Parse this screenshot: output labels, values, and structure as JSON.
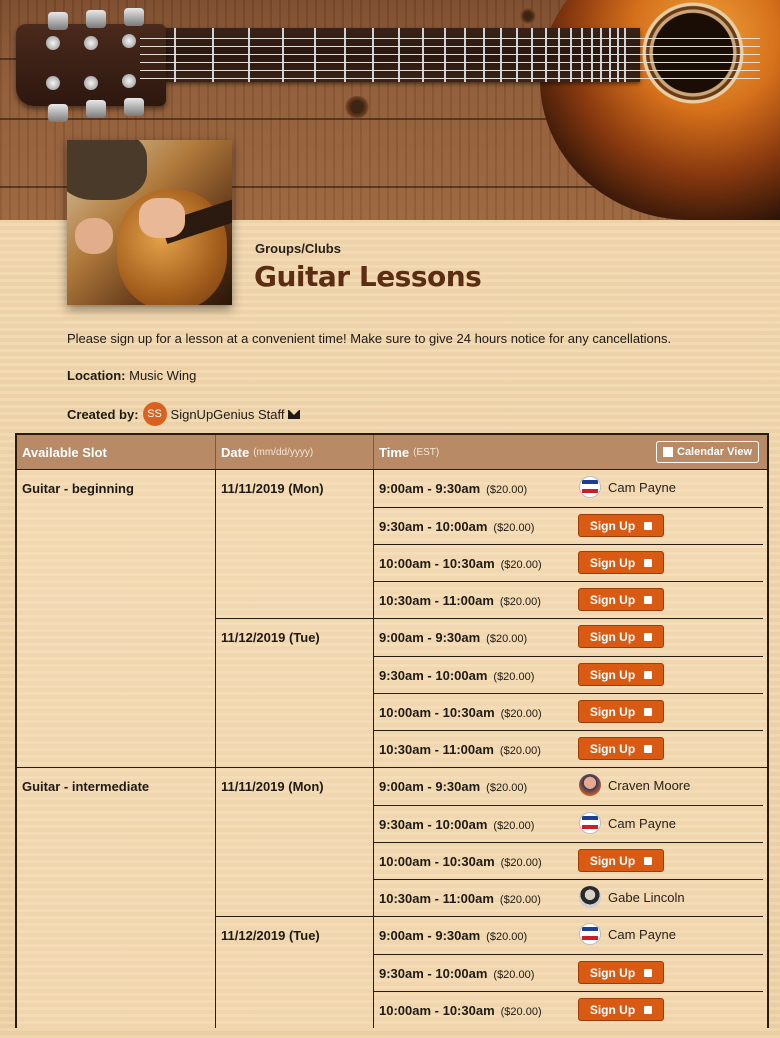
{
  "header": {
    "category": "Groups/Clubs",
    "title": "Guitar Lessons",
    "description": "Please sign up for a lesson at a convenient time! Make sure to give 24 hours notice for any cancellations.",
    "location_label": "Location:",
    "location_value": "Music Wing",
    "created_by_label": "Created by:",
    "creator_initials": "SS",
    "creator_name": "SignUpGenius Staff"
  },
  "table": {
    "col_slot": "Available Slot",
    "col_date": "Date",
    "col_date_hint": "(mm/dd/yyyy)",
    "col_time": "Time",
    "col_time_hint": "(EST)",
    "calendar_view": "Calendar View",
    "signup_label": "Sign Up",
    "groups": [
      {
        "slot": "Guitar - beginning",
        "dates": [
          {
            "date": "11/11/2019 (Mon)",
            "times": [
              {
                "time": "9:00am - 9:30am",
                "price": "($20.00)",
                "taken_by": "Cam Payne",
                "avatar": "vote-icon"
              },
              {
                "time": "9:30am - 10:00am",
                "price": "($20.00)"
              },
              {
                "time": "10:00am - 10:30am",
                "price": "($20.00)"
              },
              {
                "time": "10:30am - 11:00am",
                "price": "($20.00)"
              }
            ]
          },
          {
            "date": "11/12/2019 (Tue)",
            "times": [
              {
                "time": "9:00am - 9:30am",
                "price": "($20.00)"
              },
              {
                "time": "9:30am - 10:00am",
                "price": "($20.00)"
              },
              {
                "time": "10:00am - 10:30am",
                "price": "($20.00)"
              },
              {
                "time": "10:30am - 11:00am",
                "price": "($20.00)"
              }
            ]
          }
        ]
      },
      {
        "slot": "Guitar - intermediate",
        "dates": [
          {
            "date": "11/11/2019 (Mon)",
            "times": [
              {
                "time": "9:00am - 9:30am",
                "price": "($20.00)",
                "taken_by": "Craven Moore",
                "avatar": "craven-avatar"
              },
              {
                "time": "9:30am - 10:00am",
                "price": "($20.00)",
                "taken_by": "Cam Payne",
                "avatar": "vote-icon"
              },
              {
                "time": "10:00am - 10:30am",
                "price": "($20.00)"
              },
              {
                "time": "10:30am - 11:00am",
                "price": "($20.00)",
                "taken_by": "Gabe Lincoln",
                "avatar": "gabe-avatar"
              }
            ]
          },
          {
            "date": "11/12/2019 (Tue)",
            "times": [
              {
                "time": "9:00am - 9:30am",
                "price": "($20.00)",
                "taken_by": "Cam Payne",
                "avatar": "vote-icon"
              },
              {
                "time": "9:30am - 10:00am",
                "price": "($20.00)"
              },
              {
                "time": "10:00am - 10:30am",
                "price": "($20.00)"
              }
            ]
          }
        ]
      }
    ]
  },
  "colors": {
    "accent": "#d85a13",
    "header_row": "#b88a66",
    "title": "#5b2d12"
  }
}
